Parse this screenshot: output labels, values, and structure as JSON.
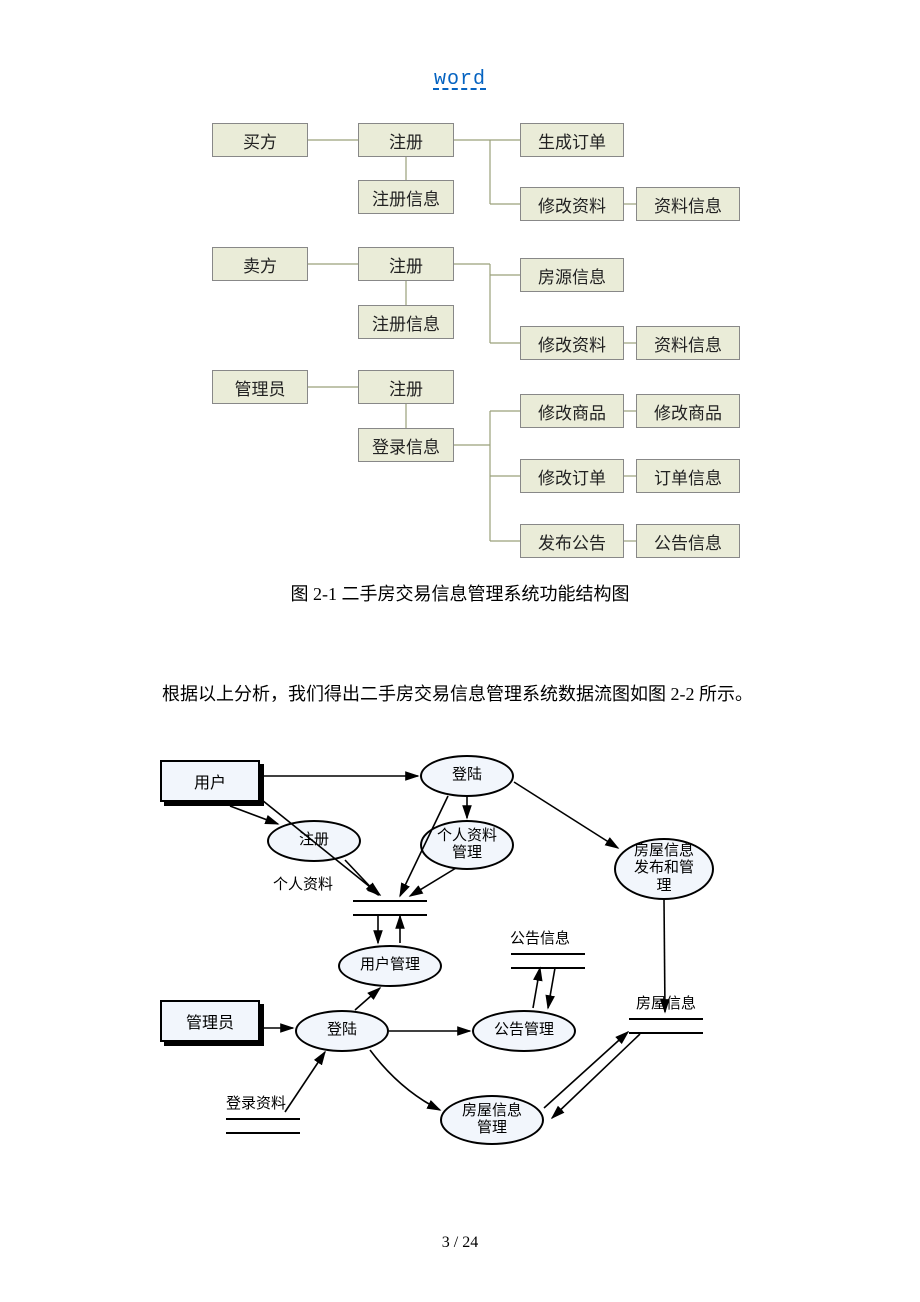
{
  "header_link": "word",
  "tree": {
    "col1": {
      "buyer": "买方",
      "seller": "卖方",
      "admin": "管理员"
    },
    "col2": {
      "register1": "注册",
      "reginfo1": "注册信息",
      "register2": "注册",
      "reginfo2": "注册信息",
      "register3": "注册",
      "logininfo": "登录信息"
    },
    "col3": {
      "gen_order": "生成订单",
      "edit_profile1": "修改资料",
      "house_info": "房源信息",
      "edit_profile2": "修改资料",
      "edit_product": "修改商品",
      "edit_order": "修改订单",
      "publish_notice": "发布公告"
    },
    "col4": {
      "profile_info1": "资料信息",
      "profile_info2": "资料信息",
      "product_edit": "修改商品",
      "order_info": "订单信息",
      "notice_info": "公告信息"
    }
  },
  "caption1": "图 2-1 二手房交易信息管理系统功能结构图",
  "paragraph": "根据以上分析，我们得出二手房交易信息管理系统数据流图如图 2-2 所示。",
  "dfd": {
    "user": "用户",
    "admin": "管理员",
    "register": "注册",
    "login1": "登陆",
    "login2": "登陆",
    "profile_mgmt": "个人资料\n管理",
    "house_pub": "房屋信息\n发布和管\n理",
    "user_mgmt": "用户管理",
    "notice_mgmt": "公告管理",
    "house_mgmt": "房屋信息\n管理",
    "label_personal": "个人资料",
    "label_notice": "公告信息",
    "label_house": "房屋信息",
    "label_login": "登录资料"
  },
  "page_number": "3 / 24",
  "chart_data": {
    "type": "diagram",
    "diagrams": [
      {
        "name": "Function Structure Diagram (图 2-1)",
        "nodes": [
          "买方",
          "卖方",
          "管理员",
          "注册",
          "注册信息",
          "登录信息",
          "生成订单",
          "修改资料",
          "房源信息",
          "修改商品",
          "修改订单",
          "发布公告",
          "资料信息",
          "订单信息",
          "公告信息"
        ],
        "edges": [
          [
            "买方",
            "注册"
          ],
          [
            "注册",
            "生成订单"
          ],
          [
            "注册",
            "修改资料"
          ],
          [
            "修改资料",
            "资料信息"
          ],
          [
            "卖方",
            "注册"
          ],
          [
            "注册",
            "房源信息"
          ],
          [
            "注册",
            "修改资料"
          ],
          [
            "修改资料",
            "资料信息"
          ],
          [
            "管理员",
            "注册"
          ],
          [
            "注册",
            "登录信息"
          ],
          [
            "登录信息",
            "修改商品"
          ],
          [
            "修改商品",
            "修改商品"
          ],
          [
            "登录信息",
            "修改订单"
          ],
          [
            "修改订单",
            "订单信息"
          ],
          [
            "登录信息",
            "发布公告"
          ],
          [
            "发布公告",
            "公告信息"
          ]
        ]
      },
      {
        "name": "Data Flow Diagram (图 2-2)",
        "external_entities": [
          "用户",
          "管理员"
        ],
        "processes": [
          "注册",
          "登陆(用户)",
          "个人资料管理",
          "房屋信息发布和管理",
          "用户管理",
          "登陆(管理员)",
          "公告管理",
          "房屋信息管理"
        ],
        "data_stores": [
          "个人资料",
          "公告信息",
          "房屋信息",
          "登录资料"
        ],
        "flows": [
          [
            "用户",
            "注册"
          ],
          [
            "用户",
            "登陆(用户)"
          ],
          [
            "注册",
            "个人资料"
          ],
          [
            "登陆(用户)",
            "个人资料管理"
          ],
          [
            "登陆(用户)",
            "房屋信息发布和管理"
          ],
          [
            "个人资料管理",
            "个人资料"
          ],
          [
            "个人资料",
            "用户管理"
          ],
          [
            "管理员",
            "登陆(管理员)"
          ],
          [
            "登录资料",
            "登陆(管理员)"
          ],
          [
            "登陆(管理员)",
            "用户管理"
          ],
          [
            "登陆(管理员)",
            "公告管理"
          ],
          [
            "公告管理",
            "公告信息"
          ],
          [
            "登陆(管理员)",
            "房屋信息管理"
          ],
          [
            "房屋信息管理",
            "房屋信息"
          ],
          [
            "房屋信息发布和管理",
            "房屋信息"
          ]
        ]
      }
    ]
  }
}
